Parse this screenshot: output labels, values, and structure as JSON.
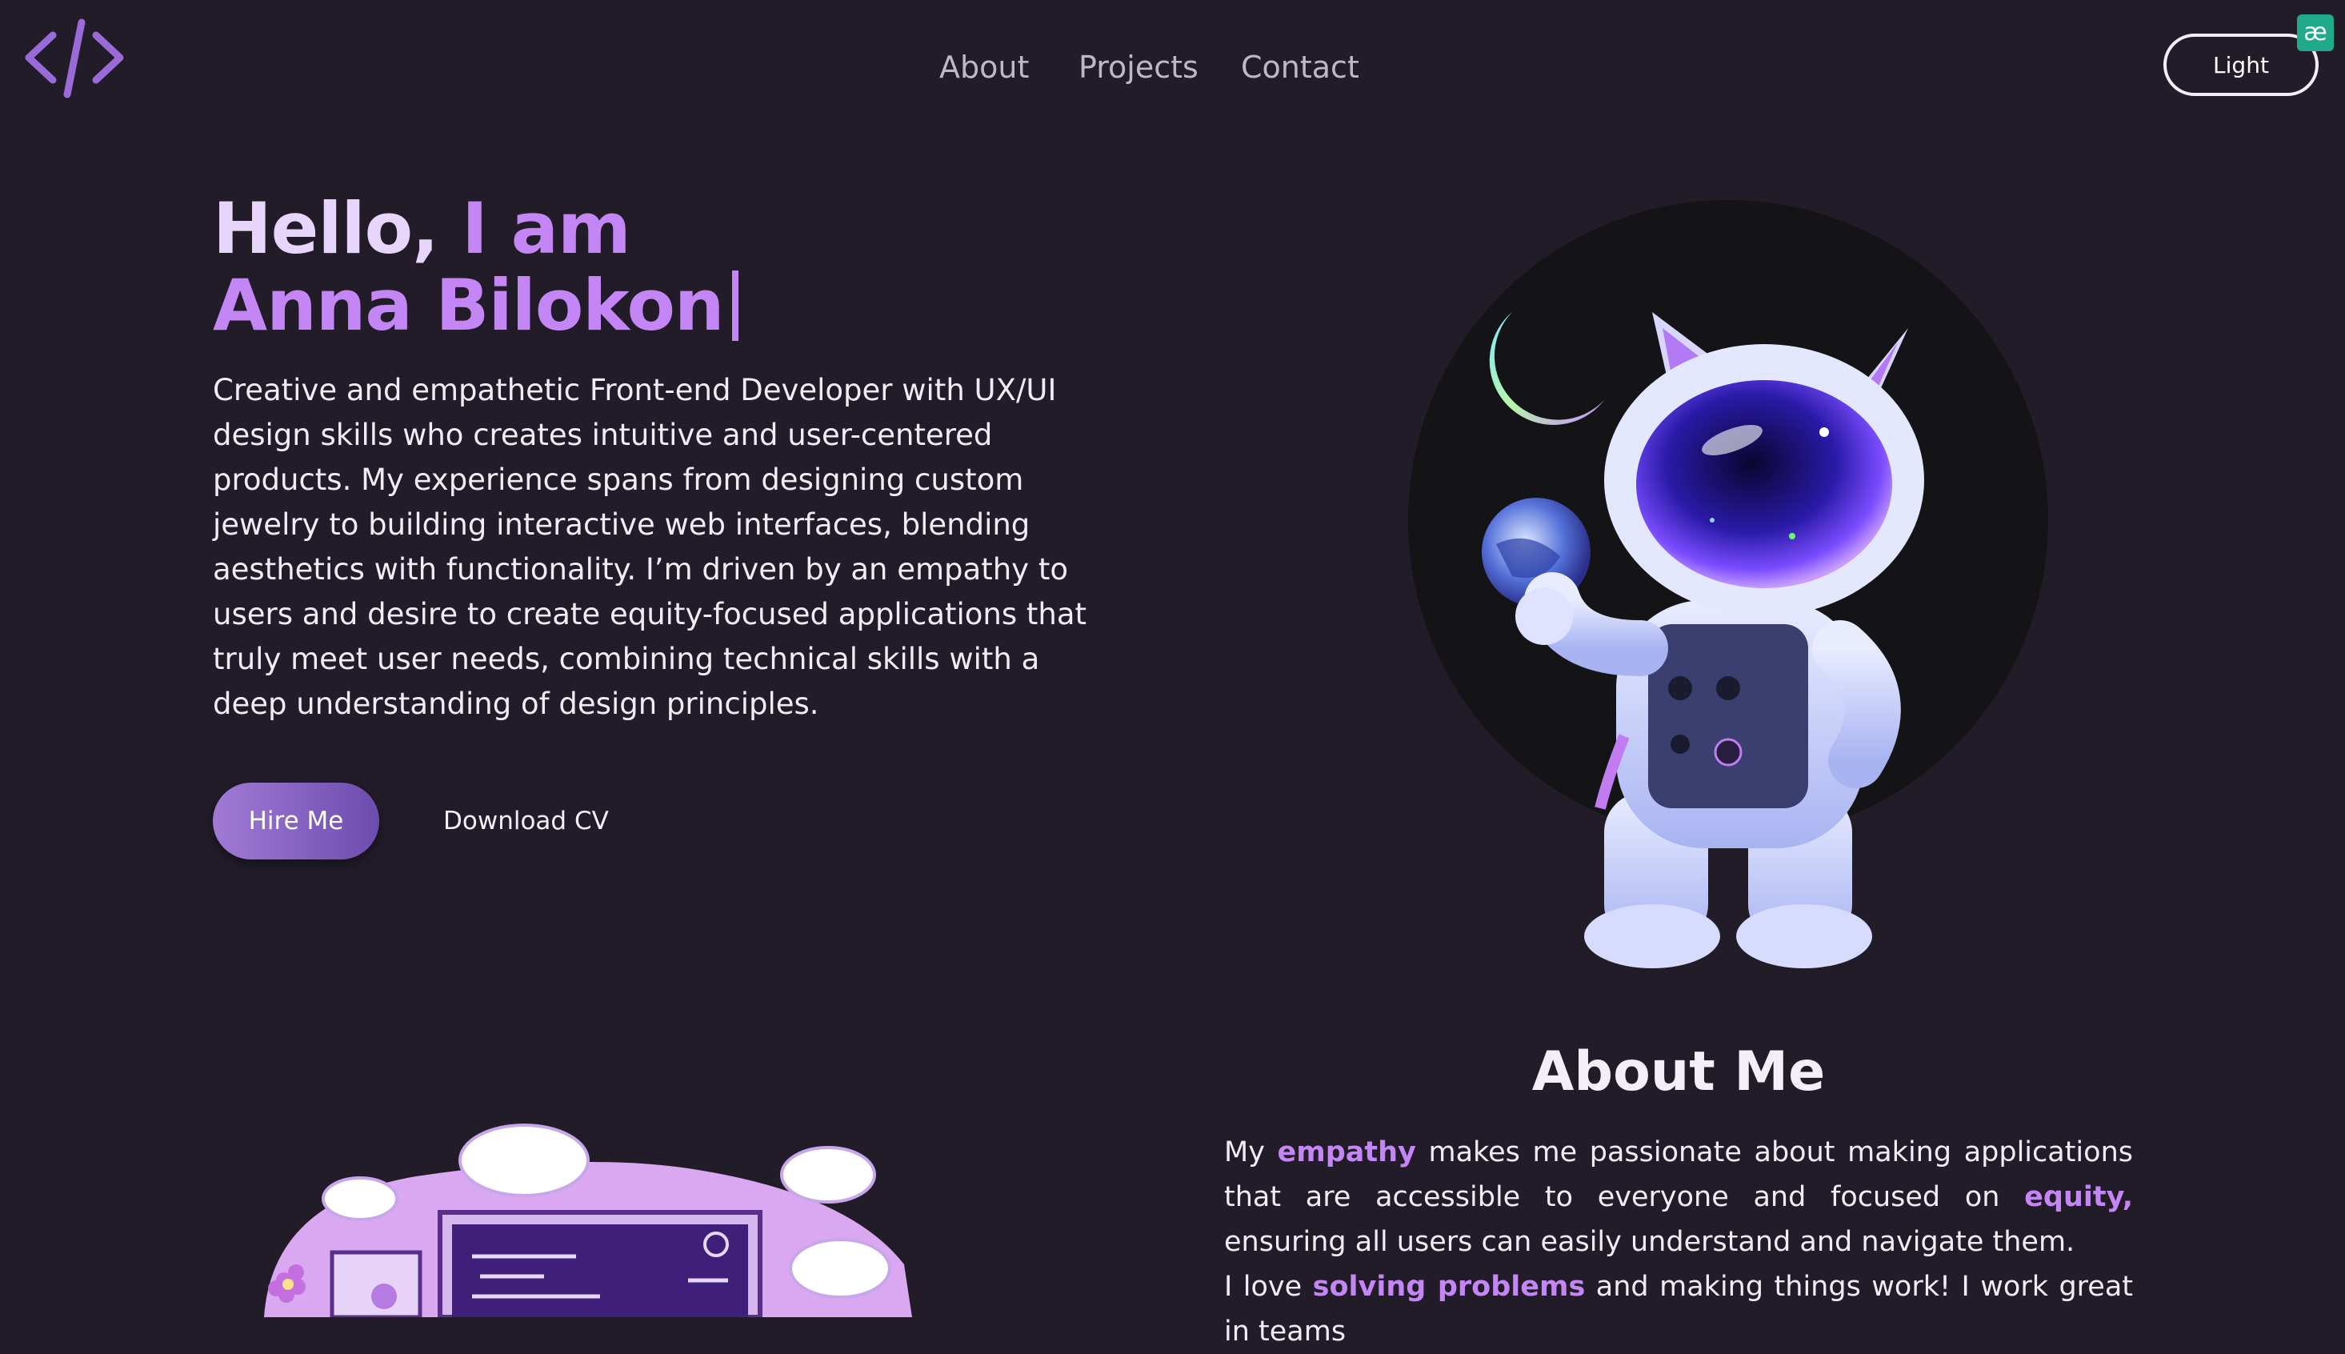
{
  "header": {
    "logo_icon": "code-brackets-icon",
    "nav": [
      "About",
      "Projects",
      "Contact"
    ],
    "theme_toggle_label": "Light",
    "extension_badge": "æ"
  },
  "hero": {
    "greeting_white": "Hello,",
    "greeting_purple": " I am",
    "name": "Anna Bilokon",
    "bio": "Creative and empathetic Front-end Developer with UX/UI design skills who creates intuitive and user-centered products. My experience spans from designing custom jewelry to building interactive web interfaces, blending aesthetics with functionality. I’m driven by an empathy to users and desire to create equity-focused applications that truly meet user needs, combining technical skills with a deep understanding of design principles.",
    "hire_label": "Hire Me",
    "cv_label": "Download CV",
    "illustration": "astronaut-cat-illustration"
  },
  "about": {
    "title": "About Me",
    "p1_a": "My ",
    "p1_hl1": "empathy",
    "p1_b": " makes me passionate about making applications that are accessible to everyone and focused on ",
    "p1_hl2": "equity,",
    "p1_c": " ensuring all users can easily understand and navigate them.",
    "p2_a": "I love ",
    "p2_hl": "solving problems",
    "p2_b": " and making things work! I work great in teams",
    "illustration": "cloud-laptop-illustration"
  },
  "colors": {
    "background": "#211c28",
    "accent": "#c486f5",
    "button_gradient": [
      "#a27ad6",
      "#6c4cae"
    ],
    "badge": "#21a98c"
  }
}
